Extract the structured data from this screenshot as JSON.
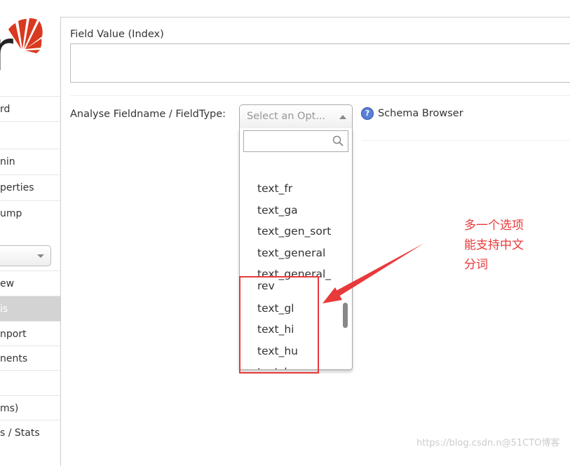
{
  "sidebar": {
    "logo": "solr-logo",
    "items": [
      {
        "label": "rd",
        "active": false
      },
      {
        "label": "",
        "active": false
      },
      {
        "label": "nin",
        "active": false
      },
      {
        "label": "perties",
        "active": false
      },
      {
        "label": "ump",
        "active": false
      },
      {
        "label": "ew",
        "active": false
      },
      {
        "label": "is",
        "active": true
      },
      {
        "label": "nport",
        "active": false
      },
      {
        "label": "nents",
        "active": false
      },
      {
        "label": "",
        "active": false
      },
      {
        "label": "ms)",
        "active": false
      },
      {
        "label": "s / Stats",
        "active": false
      }
    ]
  },
  "main": {
    "field_value_label": "Field Value (Index)",
    "field_value": "",
    "analyse_label": "Analyse Fieldname / FieldType:",
    "select_placeholder": "Select an Opt...",
    "search_value": "",
    "options": [
      "text_fr",
      "text_ga",
      "text_gen_sort",
      "text_general",
      "text_general_\nrev",
      "text_gl",
      "text_hi",
      "text_hu",
      "text_hy"
    ],
    "schema_browser": "Schema Browser"
  },
  "annotation": {
    "lines": [
      "多一个选项",
      "能支持中文",
      "分词"
    ],
    "color": "#e8393b"
  },
  "watermark": "https://blog.csdn.n@51CTO博客"
}
